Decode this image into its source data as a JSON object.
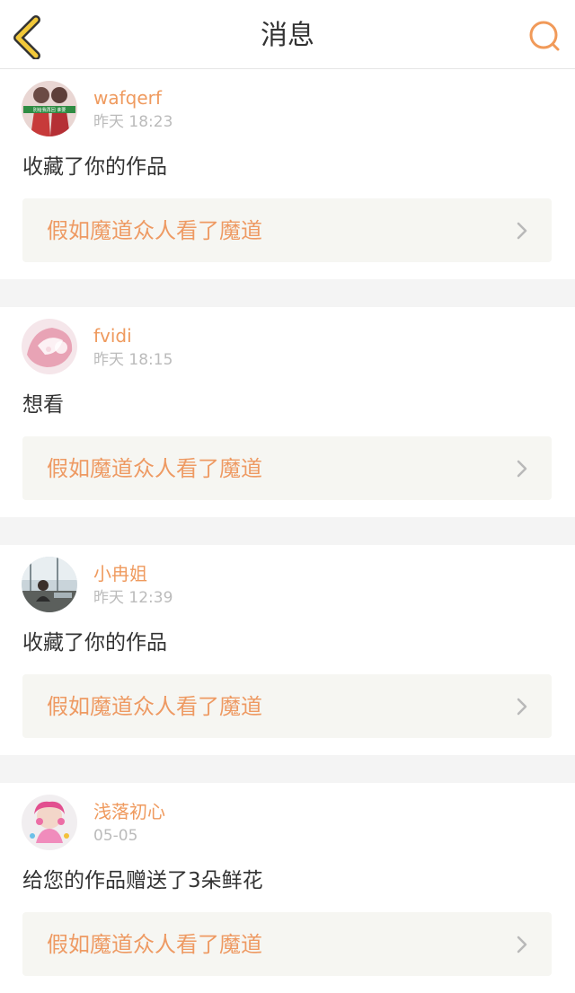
{
  "header": {
    "title": "消息",
    "back_icon": "chevron-left-icon",
    "search_icon": "search-icon",
    "accent": "#f2c93a",
    "search_color": "#f19a59"
  },
  "messages": [
    {
      "username": "wafqerf",
      "time": "昨天 18:23",
      "text": "收藏了你的作品",
      "work_title": "假如魔道众人看了魔道",
      "avatar_banner_text": "別给我再回 谁要"
    },
    {
      "username": "fvidi",
      "time": "昨天 18:15",
      "text": "想看",
      "work_title": "假如魔道众人看了魔道"
    },
    {
      "username": "小冉姐",
      "time": "昨天 12:39",
      "text": "收藏了你的作品",
      "work_title": "假如魔道众人看了魔道"
    },
    {
      "username": "浅落初心",
      "time": "05-05",
      "text": "给您的作品赠送了3朵鲜花",
      "work_title": "假如魔道众人看了魔道"
    }
  ],
  "colors": {
    "username": "#ef9a5e",
    "work_title": "#ee9a63",
    "time": "#bbbbbb",
    "card_bg": "#f6f6f2",
    "divider": "#f4f4f4"
  }
}
